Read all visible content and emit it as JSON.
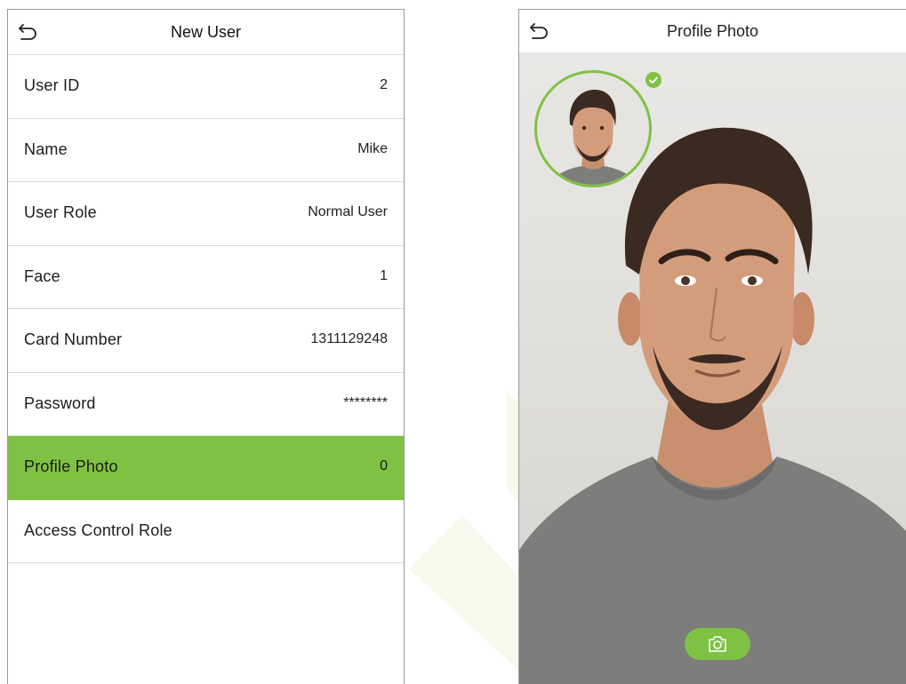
{
  "left_screen": {
    "title": "New User",
    "back_icon": "back-arrow-icon",
    "items": [
      {
        "label": "User ID",
        "value": "2"
      },
      {
        "label": "Name",
        "value": "Mike"
      },
      {
        "label": "User Role",
        "value": "Normal User"
      },
      {
        "label": "Face",
        "value": "1"
      },
      {
        "label": "Card Number",
        "value": "1311129248"
      },
      {
        "label": "Password",
        "value": "********"
      },
      {
        "label": "Profile Photo",
        "value": "0"
      },
      {
        "label": "Access Control Role",
        "value": ""
      }
    ],
    "active_index": 6
  },
  "right_screen": {
    "title": "Profile Photo",
    "back_icon": "back-arrow-icon",
    "capture_icon": "camera-icon",
    "check_icon": "check-icon"
  },
  "colors": {
    "accent": "#7fc243",
    "border": "#9a9a9a",
    "divider": "#d9d9d9"
  }
}
